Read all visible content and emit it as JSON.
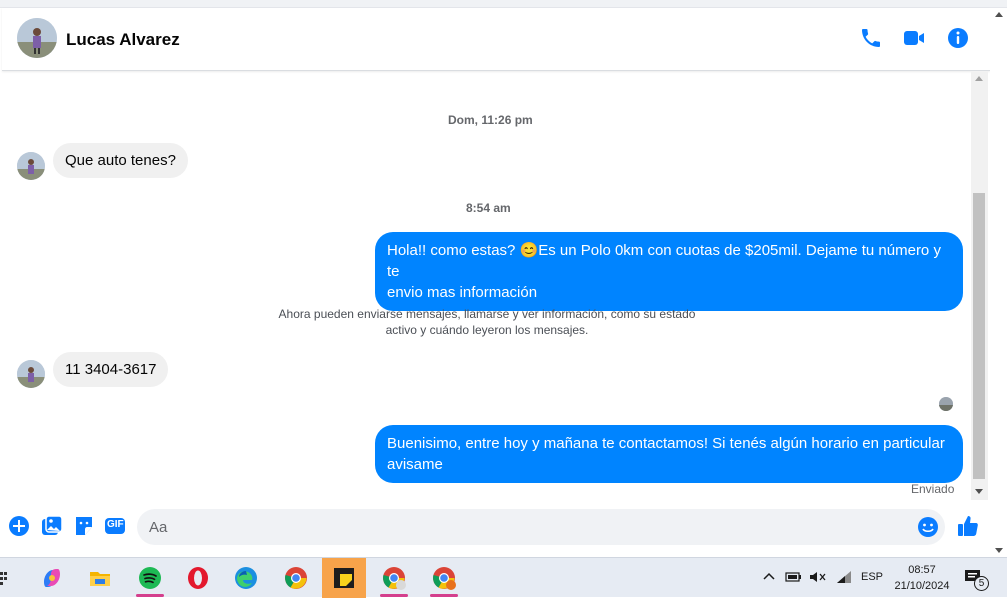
{
  "contact": {
    "name": "Lucas Alvarez"
  },
  "header_icons": [
    "phone-icon",
    "video-camera-icon",
    "info-icon"
  ],
  "messages": {
    "timestamp_1": "Dom, 11:26 pm",
    "in_1": "Que auto tenes?",
    "timestamp_2": "8:54 am",
    "out_1_line1": "Hola!! como estas? 😊Es un Polo 0km con cuotas de $205mil. Dejame tu número y te",
    "out_1_line2": "envio mas información",
    "system_line1": "Ahora pueden enviarse mensajes, llamarse y ver información, como su estado",
    "system_line2": "activo y cuándo leyeron los mensajes.",
    "in_2": "11 3404-3617",
    "out_2_line1": "Buenisimo, entre hoy y mañana te contactamos! Si tenés algún horario en particular",
    "out_2_line2": "avisame",
    "status": "Enviado"
  },
  "composer": {
    "placeholder": "Aa",
    "icons": [
      "plus-circle-icon",
      "photo-icon",
      "sticker-icon",
      "gif-icon",
      "emoji-icon",
      "thumbs-up-icon"
    ],
    "gif_label": "GIF"
  },
  "taskbar": {
    "apps": [
      "copilot-icon",
      "file-explorer-icon",
      "spotify-icon",
      "opera-icon",
      "edge-icon",
      "chrome-icon",
      "sticky-notes-icon",
      "chrome-profile-icon",
      "chrome-profile-2-icon"
    ],
    "language": "ESP",
    "time": "08:57",
    "date": "21/10/2024",
    "notification_count": "5"
  },
  "colors": {
    "accent": "#0084ff",
    "icon_blue": "#0a7cff",
    "incoming_bubble": "#f0f0f0",
    "taskbar": "#e6ebf3"
  }
}
